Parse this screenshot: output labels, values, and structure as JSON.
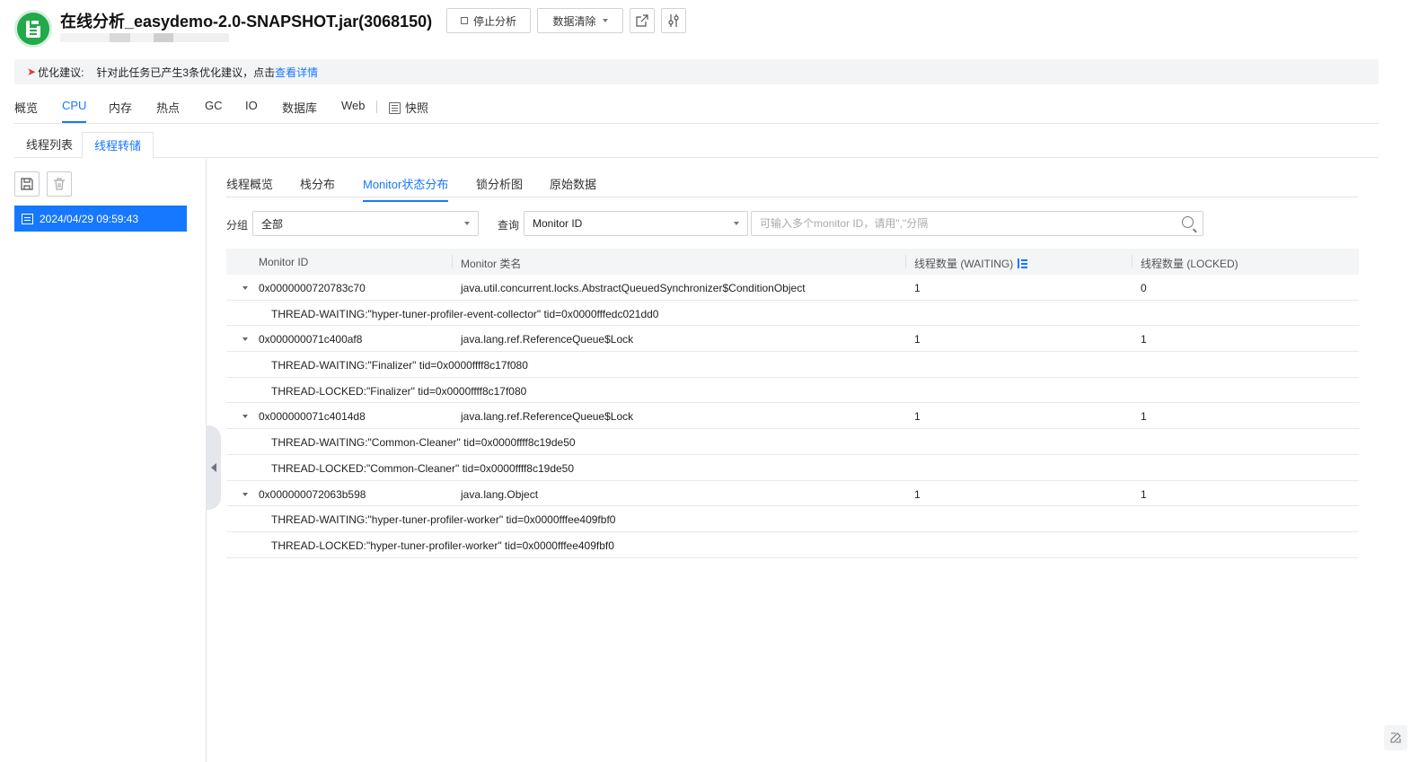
{
  "header": {
    "title": "在线分析_easydemo-2.0-SNAPSHOT.jar(3068150)",
    "stop_label": "停止分析",
    "clear_label": "数据清除"
  },
  "suggestion": {
    "label": "优化建议:",
    "text": "针对此任务已产生3条优化建议，点击",
    "link": "查看详情"
  },
  "main_tabs": [
    "概览",
    "CPU",
    "内存",
    "热点",
    "GC",
    "IO",
    "数据库",
    "Web",
    "快照"
  ],
  "main_tab_active": "CPU",
  "sub_tabs": [
    "线程列表",
    "线程转储"
  ],
  "sub_tab_active": "线程转储",
  "dumps": [
    {
      "label": "2024/04/29 09:59:43"
    }
  ],
  "inner_tabs": [
    "线程概览",
    "栈分布",
    "Monitor状态分布",
    "锁分析图",
    "原始数据"
  ],
  "inner_tab_active": "Monitor状态分布",
  "filters": {
    "group_label": "分组",
    "group_value": "全部",
    "query_label": "查询",
    "query_value": "Monitor ID",
    "search_placeholder": "可输入多个monitor ID，请用\",\"分隔"
  },
  "table": {
    "columns": [
      "Monitor ID",
      "Monitor 类名",
      "线程数量 (WAITING)",
      "线程数量 (LOCKED)"
    ],
    "rows": [
      {
        "type": "monitor",
        "id": "0x0000000720783c70",
        "class": "java.util.concurrent.locks.AbstractQueuedSynchronizer$ConditionObject",
        "waiting": "1",
        "locked": "0"
      },
      {
        "type": "thread",
        "text": "THREAD-WAITING:\"hyper-tuner-profiler-event-collector\" tid=0x0000fffedc021dd0"
      },
      {
        "type": "monitor",
        "id": "0x000000071c400af8",
        "class": "java.lang.ref.ReferenceQueue$Lock",
        "waiting": "1",
        "locked": "1"
      },
      {
        "type": "thread",
        "text": "THREAD-WAITING:\"Finalizer\" tid=0x0000ffff8c17f080"
      },
      {
        "type": "thread",
        "text": "THREAD-LOCKED:\"Finalizer\" tid=0x0000ffff8c17f080"
      },
      {
        "type": "monitor",
        "id": "0x000000071c4014d8",
        "class": "java.lang.ref.ReferenceQueue$Lock",
        "waiting": "1",
        "locked": "1"
      },
      {
        "type": "thread",
        "text": "THREAD-WAITING:\"Common-Cleaner\" tid=0x0000ffff8c19de50"
      },
      {
        "type": "thread",
        "text": "THREAD-LOCKED:\"Common-Cleaner\" tid=0x0000ffff8c19de50"
      },
      {
        "type": "monitor",
        "id": "0x000000072063b598",
        "class": "java.lang.Object",
        "waiting": "1",
        "locked": "1"
      },
      {
        "type": "thread",
        "text": "THREAD-WAITING:\"hyper-tuner-profiler-worker\" tid=0x0000fffee409fbf0"
      },
      {
        "type": "thread",
        "text": "THREAD-LOCKED:\"hyper-tuner-profiler-worker\" tid=0x0000fffee409fbf0"
      }
    ]
  },
  "icons": {
    "logo": "clipboard-icon",
    "share": "external-link-icon",
    "tune": "sliders-icon",
    "save": "save-icon",
    "delete": "trash-icon",
    "search": "search-icon",
    "edit": "edit-icon"
  },
  "colors": {
    "accent": "#1677ff",
    "logo": "#21a94a"
  }
}
